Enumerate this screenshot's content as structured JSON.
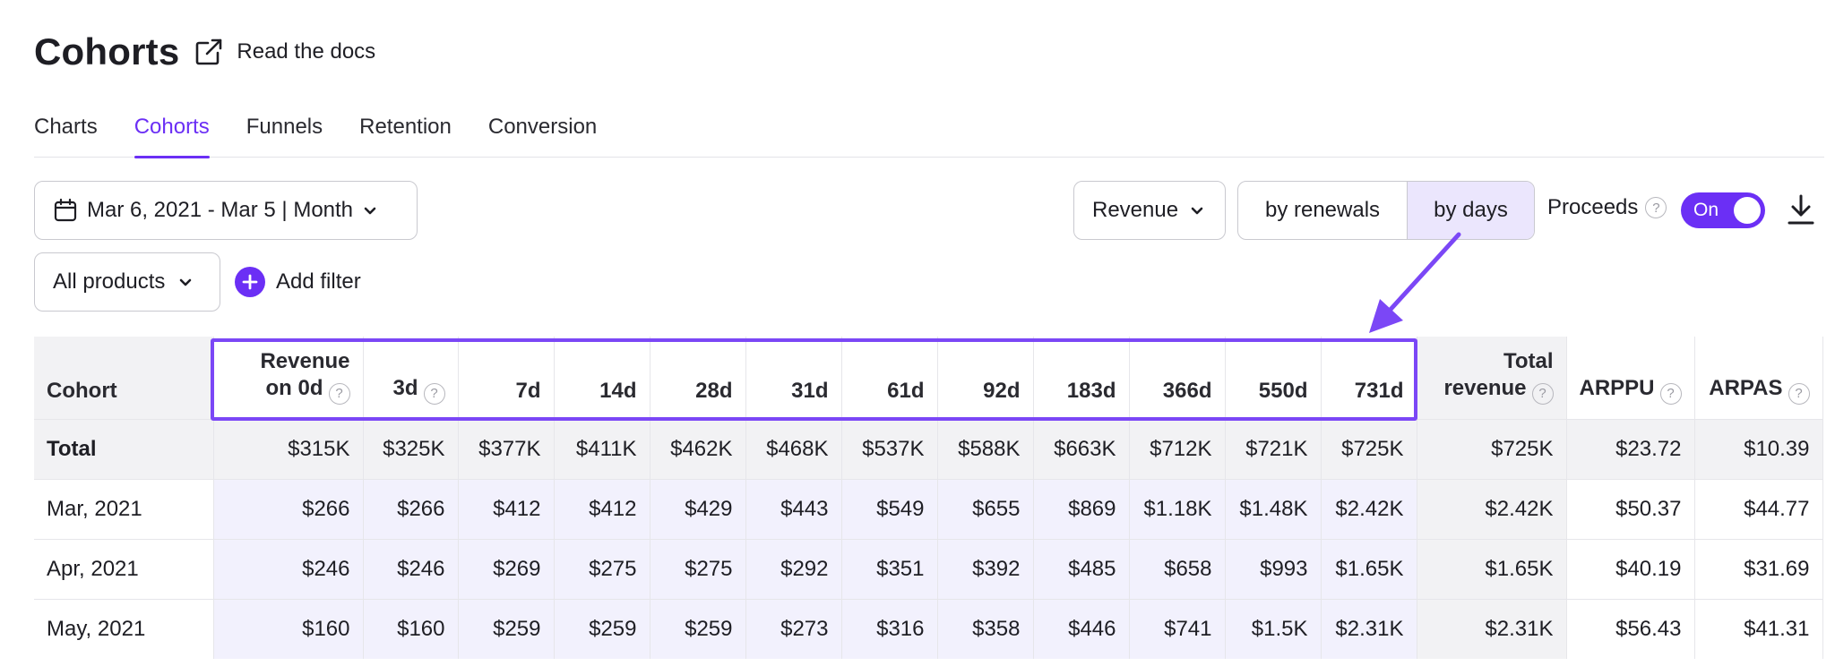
{
  "header": {
    "title": "Cohorts",
    "docs_link": "Read the docs"
  },
  "tabs": [
    {
      "label": "Charts",
      "active": false
    },
    {
      "label": "Cohorts",
      "active": true
    },
    {
      "label": "Funnels",
      "active": false
    },
    {
      "label": "Retention",
      "active": false
    },
    {
      "label": "Conversion",
      "active": false
    }
  ],
  "filters": {
    "date_range": "Mar 6, 2021 - Mar 5 | Month",
    "products": "All products",
    "add_filter": "Add filter",
    "metric": "Revenue",
    "mode_options": [
      "by renewals",
      "by days"
    ],
    "mode_selected": "by days",
    "proceeds_label": "Proceeds",
    "proceeds_toggle": "On"
  },
  "icons": {
    "external_link": "external-link-icon",
    "calendar": "calendar-icon",
    "chevron": "chevron-down-icon",
    "plus": "plus-icon",
    "help": "question-icon",
    "download": "download-icon"
  },
  "colors": {
    "accent": "#6b2ff5",
    "highlight": "#7b47f6",
    "lavender": "#f2f1fd",
    "gray": "#f2f2f4"
  },
  "table": {
    "headers": {
      "cohort": "Cohort",
      "rev0_line1": "Revenue",
      "rev0_line2": "on 0d",
      "d3": "3d",
      "d7": "7d",
      "d14": "14d",
      "d28": "28d",
      "d31": "31d",
      "d61": "61d",
      "d92": "92d",
      "d183": "183d",
      "d366": "366d",
      "d550": "550d",
      "d731": "731d",
      "total_line1": "Total",
      "total_line2": "revenue",
      "arppu": "ARPPU",
      "arpas": "ARPAS"
    },
    "rows": [
      {
        "cohort": "Total",
        "values": [
          "$315K",
          "$325K",
          "$377K",
          "$411K",
          "$462K",
          "$468K",
          "$537K",
          "$588K",
          "$663K",
          "$712K",
          "$721K",
          "$725K"
        ],
        "total": "$725K",
        "arppu": "$23.72",
        "arpas": "$10.39"
      },
      {
        "cohort": "Mar, 2021",
        "values": [
          "$266",
          "$266",
          "$412",
          "$412",
          "$429",
          "$443",
          "$549",
          "$655",
          "$869",
          "$1.18K",
          "$1.48K",
          "$2.42K"
        ],
        "total": "$2.42K",
        "arppu": "$50.37",
        "arpas": "$44.77"
      },
      {
        "cohort": "Apr, 2021",
        "values": [
          "$246",
          "$246",
          "$269",
          "$275",
          "$275",
          "$292",
          "$351",
          "$392",
          "$485",
          "$658",
          "$993",
          "$1.65K"
        ],
        "total": "$1.65K",
        "arppu": "$40.19",
        "arpas": "$31.69"
      },
      {
        "cohort": "May, 2021",
        "values": [
          "$160",
          "$160",
          "$259",
          "$259",
          "$259",
          "$273",
          "$316",
          "$358",
          "$446",
          "$741",
          "$1.5K",
          "$2.31K"
        ],
        "total": "$2.31K",
        "arppu": "$56.43",
        "arpas": "$41.31"
      }
    ]
  }
}
